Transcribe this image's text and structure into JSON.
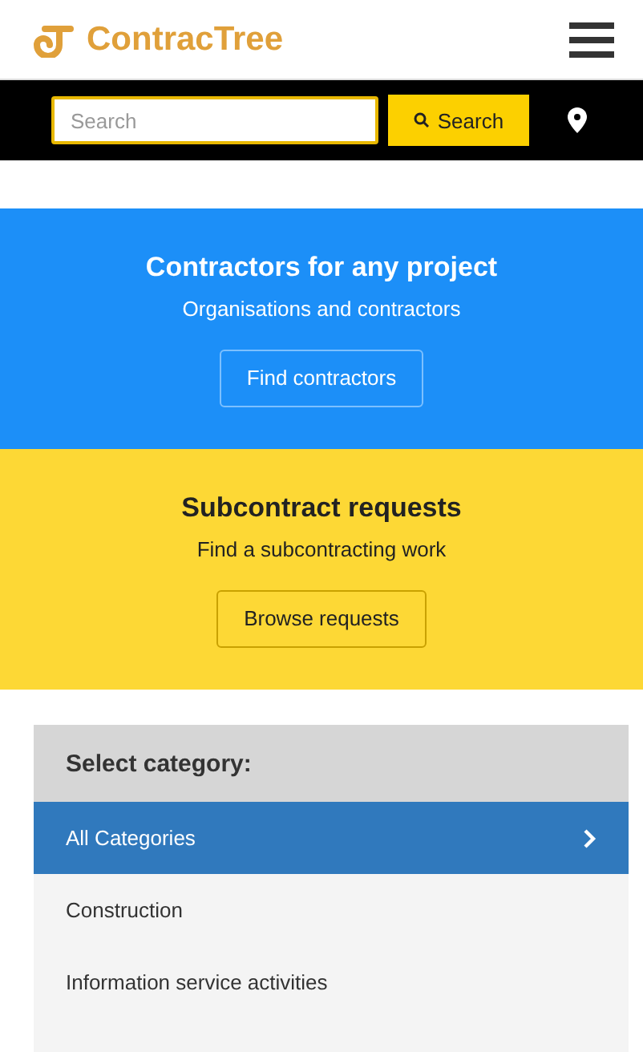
{
  "header": {
    "logo_text": "ContracTree"
  },
  "search": {
    "placeholder": "Search",
    "button": "Search"
  },
  "hero_contractors": {
    "title": "Contractors for any project",
    "subtitle": "Organisations and contractors",
    "button": "Find contractors"
  },
  "hero_requests": {
    "title": "Subcontract requests",
    "subtitle": "Find a subcontracting work",
    "button": "Browse requests"
  },
  "categories": {
    "title": "Select category:",
    "items": [
      {
        "label": "All Categories",
        "selected": true
      },
      {
        "label": "Construction",
        "selected": false
      },
      {
        "label": "Information service activities",
        "selected": false
      }
    ]
  }
}
